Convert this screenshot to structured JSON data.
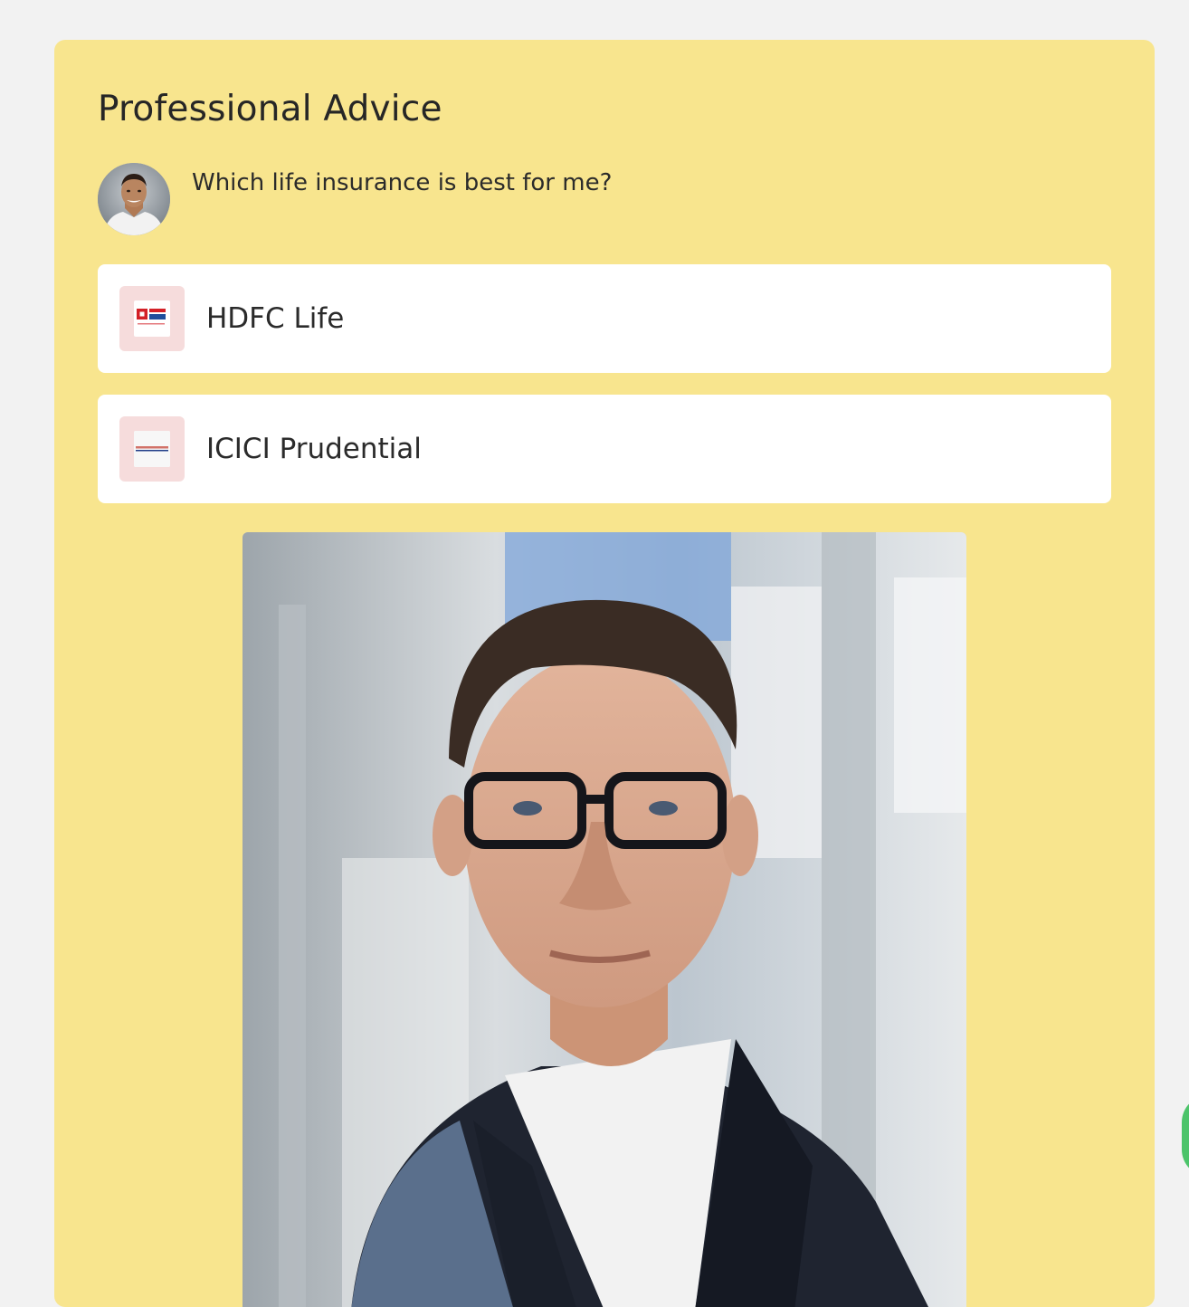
{
  "header": {
    "title": "Professional Advice"
  },
  "question": {
    "text": "Which life insurance is best for me?",
    "avatar_icon": "user-avatar"
  },
  "options": [
    {
      "label": "HDFC Life",
      "logo_icon": "hdfc-life-logo"
    },
    {
      "label": "ICICI Prudential",
      "logo_icon": "icici-prudential-logo"
    }
  ],
  "advisor_photo": {
    "icon": "advisor-portrait"
  },
  "colors": {
    "page_background": "#f2f2f2",
    "card_background": "#f8e58e",
    "option_background": "#ffffff",
    "logo_tile_background": "#f6dcdc",
    "text": "#2b2b2b",
    "floating_button": "#4cc46a"
  }
}
